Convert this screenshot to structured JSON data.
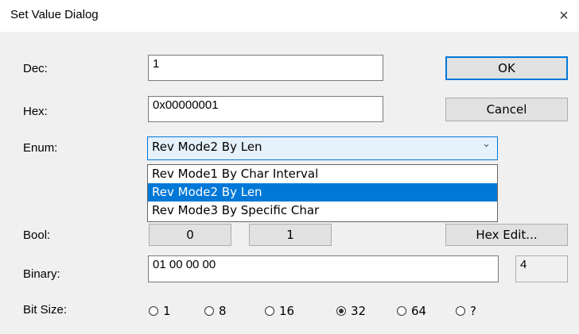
{
  "window": {
    "title": "Set Value Dialog",
    "close_glyph": "×"
  },
  "fields": {
    "dec_label": "Dec:",
    "dec_value": "1",
    "hex_label": "Hex:",
    "hex_value": "0x00000001",
    "enum_label": "Enum:",
    "enum_value": "Rev Mode2 By Len",
    "enum_options": [
      "Rev Mode1 By Char Interval",
      "Rev Mode2 By Len",
      "Rev Mode3 By Specific Char"
    ],
    "bool_label": "Bool:",
    "bool_false": "0",
    "bool_true": "1",
    "binary_label": "Binary:",
    "binary_value": "01 00 00 00",
    "binary_length": "4",
    "bitsize_label": "Bit Size:",
    "bitsize_options": [
      "1",
      "8",
      "16",
      "32",
      "64",
      "?"
    ],
    "bitsize_selected": "32"
  },
  "buttons": {
    "ok": "OK",
    "cancel": "Cancel",
    "hex_edit": "Hex Edit..."
  },
  "icons": {
    "combo_arrow": "chevron-down-icon",
    "close": "close-icon"
  },
  "colors": {
    "accent": "#0078d7",
    "dialog_bg": "#f0f0f0",
    "selected_item_bg": "#0078d7"
  }
}
